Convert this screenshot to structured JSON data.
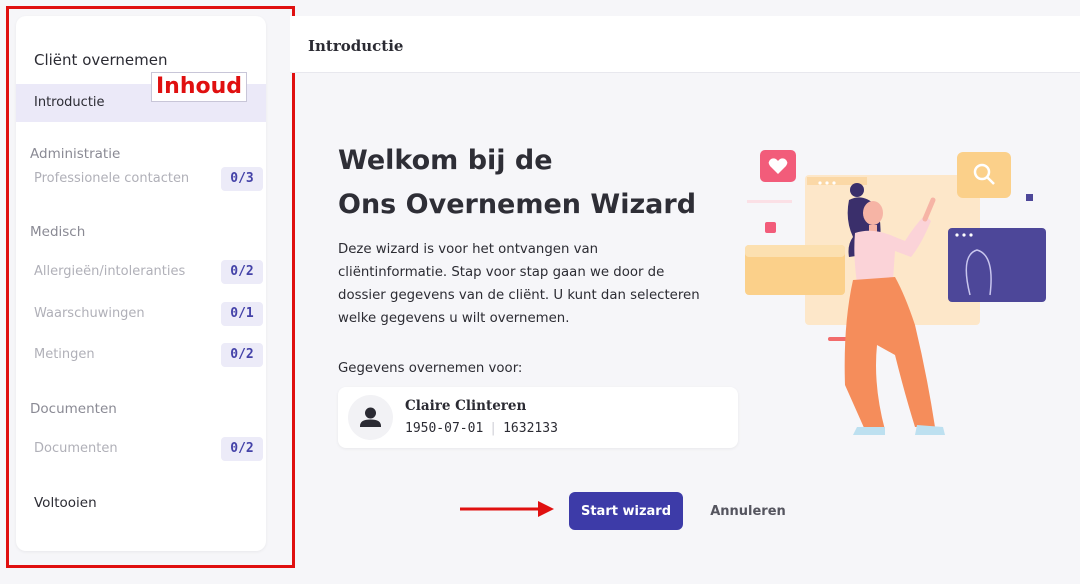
{
  "sidebar": {
    "title": "Cliënt overnemen",
    "active_item": "Introductie",
    "sections": [
      {
        "label": "Administratie"
      },
      {
        "label": "Medisch"
      },
      {
        "label": "Documenten"
      }
    ],
    "items": [
      {
        "label": "Professionele contacten",
        "badge": "0/3"
      },
      {
        "label": "Allergieën/intoleranties",
        "badge": "0/2"
      },
      {
        "label": "Waarschuwingen",
        "badge": "0/1"
      },
      {
        "label": "Metingen",
        "badge": "0/2"
      },
      {
        "label": "Documenten",
        "badge": "0/2"
      }
    ],
    "finish": "Voltooien"
  },
  "annotation": {
    "label": "Inhoud",
    "color": "#e01010"
  },
  "header": {
    "title": "Introductie"
  },
  "main": {
    "welcome_line1": "Welkom bij de",
    "welcome_line2": "Ons Overnemen Wizard",
    "description": "Deze wizard is voor het ontvangen van cliëntinformatie. Stap voor stap gaan we door de dossier gegevens van de cliënt. U kunt dan selecteren welke gegevens u wilt overnemen.",
    "for_label": "Gegevens overnemen voor:",
    "client": {
      "name": "Claire Clinteren",
      "birthdate": "1950-07-01",
      "id": "1632133"
    },
    "start_button": "Start wizard",
    "cancel_button": "Annuleren"
  },
  "colors": {
    "accent": "#3d3ba8",
    "badge_bg": "#ecebf8",
    "active_bg": "#ebe9f8"
  },
  "icons": {
    "avatar": "person-icon",
    "illustration": "woman-illustration"
  }
}
